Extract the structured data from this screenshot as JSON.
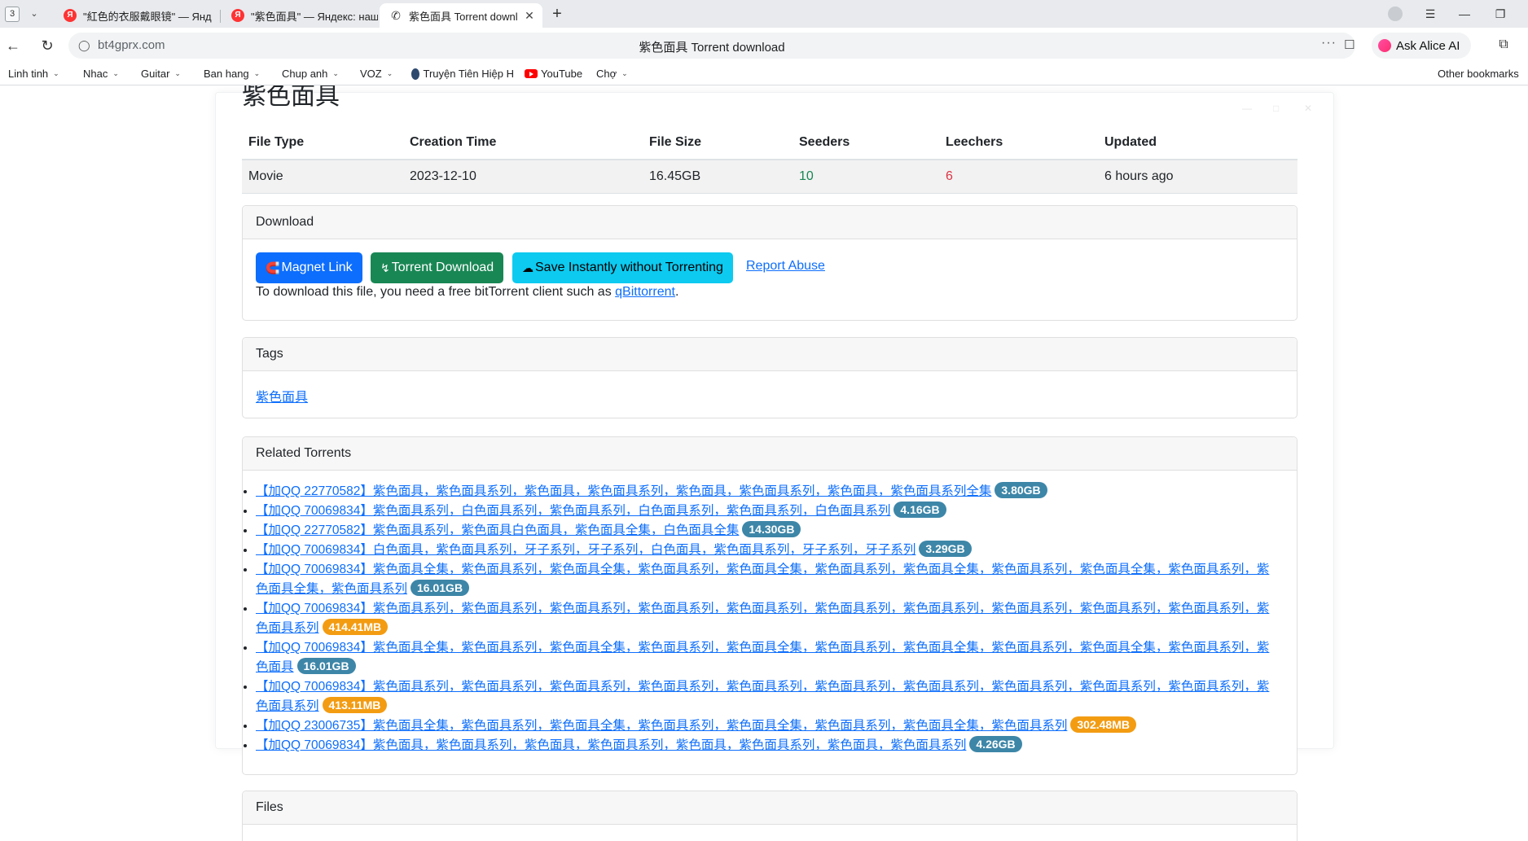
{
  "browser": {
    "tab_count": "3",
    "tabs": [
      {
        "title": "\"紅色的衣服戴眼镜\" — Янд"
      },
      {
        "title": "\"紫色面具\" — Яндекс: наш"
      },
      {
        "title": "紫色面具 Torrent downl"
      }
    ],
    "url": "bt4gprx.com",
    "page_title": "紫色面具 Torrent download",
    "alice_label": "Ask Alice AI",
    "bookmarks": [
      {
        "label": "Linh tinh"
      },
      {
        "label": "Nhac"
      },
      {
        "label": "Guitar"
      },
      {
        "label": "Ban hang"
      },
      {
        "label": "Chup anh"
      },
      {
        "label": "VOZ"
      },
      {
        "label": "Truyện Tiên Hiệp H"
      },
      {
        "label": "YouTube"
      },
      {
        "label": "Chợ"
      }
    ],
    "other_bookmarks": "Other bookmarks"
  },
  "page": {
    "heading": "紫色面具",
    "info_headers": [
      "File Type",
      "Creation Time",
      "File Size",
      "Seeders",
      "Leechers",
      "Updated"
    ],
    "info_values": [
      "Movie",
      "2023-12-10",
      "16.45GB",
      "10",
      "6",
      "6 hours ago"
    ],
    "download": {
      "header": "Download",
      "magnet_label": "Magnet Link",
      "torrent_label": "Torrent Download",
      "save_label": "Save Instantly without Torrenting",
      "report_label": "Report Abuse",
      "note_prefix": "To download this file, you need a free bitTorrent client such as ",
      "note_link": "qBittorrent",
      "note_suffix": "."
    },
    "tags": {
      "header": "Tags",
      "items": [
        "紫色面具"
      ]
    },
    "related": {
      "header": "Related Torrents",
      "items": [
        {
          "title": "【加QQ 22770582】紫色面具，紫色面具系列，紫色面具，紫色面具系列，紫色面具，紫色面具系列，紫色面具，紫色面具系列全集",
          "size": "3.80GB"
        },
        {
          "title": "【加QQ 70069834】紫色面具系列，白色面具系列，紫色面具系列，白色面具系列，紫色面具系列，白色面具系列",
          "size": "4.16GB"
        },
        {
          "title": "【加QQ 22770582】紫色面具系列，紫色面具白色面具，紫色面具全集，白色面具全集",
          "size": "14.30GB"
        },
        {
          "title": "【加QQ 70069834】白色面具，紫色面具系列，牙子系列，牙子系列，白色面具，紫色面具系列，牙子系列，牙子系列",
          "size": "3.29GB"
        },
        {
          "title": "【加QQ 70069834】紫色面具全集，紫色面具系列，紫色面具全集，紫色面具系列，紫色面具全集，紫色面具系列，紫色面具全集，紫色面具系列，紫色面具全集，紫色面具系列，紫色面具全集，紫色面具系列",
          "size": "16.01GB"
        },
        {
          "title": "【加QQ 70069834】紫色面具系列，紫色面具系列，紫色面具系列，紫色面具系列，紫色面具系列，紫色面具系列，紫色面具系列，紫色面具系列，紫色面具系列，紫色面具系列，紫色面具系列",
          "size": "414.41MB"
        },
        {
          "title": "【加QQ 70069834】紫色面具全集，紫色面具系列，紫色面具全集，紫色面具系列，紫色面具全集，紫色面具系列，紫色面具全集，紫色面具系列，紫色面具全集，紫色面具系列，紫色面具",
          "size": "16.01GB"
        },
        {
          "title": "【加QQ 70069834】紫色面具系列，紫色面具系列，紫色面具系列，紫色面具系列，紫色面具系列，紫色面具系列，紫色面具系列，紫色面具系列，紫色面具系列，紫色面具系列，紫色面具系列",
          "size": "413.11MB"
        },
        {
          "title": "【加QQ 23006735】紫色面具全集，紫色面具系列，紫色面具全集，紫色面具系列，紫色面具全集，紫色面具系列，紫色面具全集，紫色面具系列",
          "size": "302.48MB"
        },
        {
          "title": "【加QQ 70069834】紫色面具，紫色面具系列，紫色面具，紫色面具系列，紫色面具，紫色面具系列，紫色面具，紫色面具系列",
          "size": "4.26GB"
        }
      ]
    },
    "files": {
      "header": "Files"
    }
  }
}
